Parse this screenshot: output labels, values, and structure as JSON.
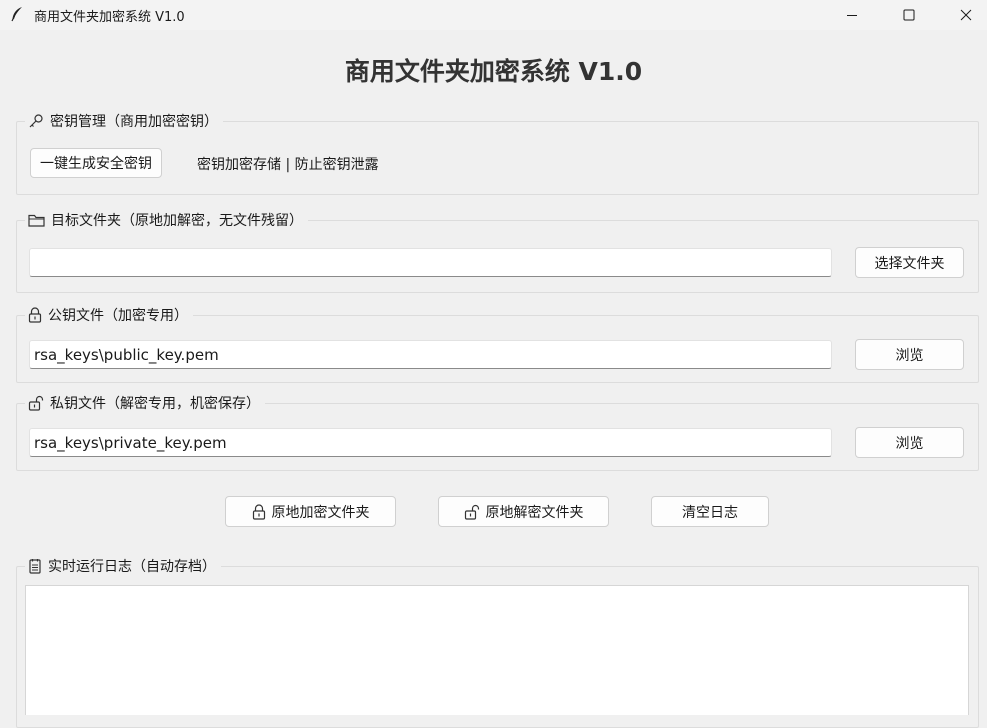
{
  "window": {
    "title": "商用文件夹加密系统 V1.0"
  },
  "app": {
    "heading": "商用文件夹加密系统 V1.0"
  },
  "key_section": {
    "legend": "密钥管理（商用加密密钥）",
    "generate_label": "一键生成安全密钥",
    "hint": "密钥加密存储 | 防止密钥泄露"
  },
  "folder_section": {
    "legend": "目标文件夹（原地加解密，无文件残留）",
    "path_value": "",
    "select_label": "选择文件夹"
  },
  "public_key_section": {
    "legend": "公钥文件（加密专用）",
    "path_value": "rsa_keys\\public_key.pem",
    "browse_label": "浏览"
  },
  "private_key_section": {
    "legend": "私钥文件（解密专用，机密保存）",
    "path_value": "rsa_keys\\private_key.pem",
    "browse_label": "浏览"
  },
  "actions": {
    "encrypt_label": "原地加密文件夹",
    "decrypt_label": "原地解密文件夹",
    "clear_label": "清空日志"
  },
  "log_section": {
    "legend": "实时运行日志（自动存档）"
  },
  "icons": {
    "app": "feather-icon",
    "key": "key-icon",
    "folder": "folder-icon",
    "lock_closed": "lock-closed-icon",
    "lock_open": "lock-open-icon",
    "log": "notepad-icon"
  }
}
